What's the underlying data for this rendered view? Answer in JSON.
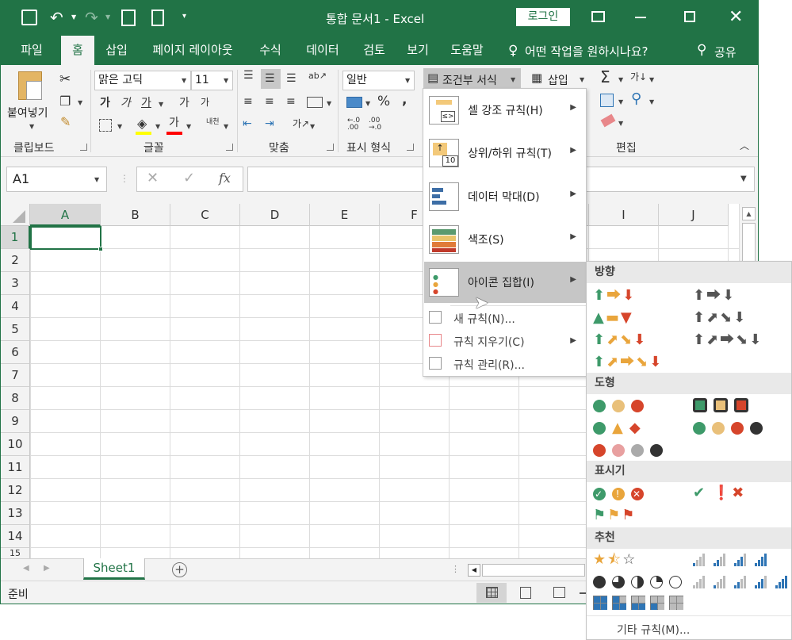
{
  "window": {
    "title": "통합 문서1  -  Excel",
    "login_label": "로그인"
  },
  "tabs": [
    {
      "label": "파일"
    },
    {
      "label": "홈"
    },
    {
      "label": "삽입"
    },
    {
      "label": "페이지 레이아웃"
    },
    {
      "label": "수식"
    },
    {
      "label": "데이터"
    },
    {
      "label": "검토"
    },
    {
      "label": "보기"
    },
    {
      "label": "도움말"
    }
  ],
  "tell_me": "어떤 작업을 원하시나요?",
  "share_label": "공유",
  "ribbon": {
    "paste_label": "붙여넣기",
    "clipboard_label": "클립보드",
    "font_label": "글꼴",
    "align_label": "맞춤",
    "number_label": "표시 형식",
    "edit_label": "편집",
    "font_name": "맑은 고딕",
    "font_size": "11",
    "number_format": "일반",
    "cond_format": "조건부 서식",
    "insert_label": "삽입",
    "bold": "가",
    "italic": "가",
    "underline": "가",
    "grow": "가",
    "shrink": "가",
    "font_color": "가",
    "phonetic": "내천",
    "percent": "%",
    "comma": ","
  },
  "formula_bar": {
    "name_box": "A1",
    "fx": "fx",
    "value": ""
  },
  "columns": [
    "A",
    "B",
    "C",
    "D",
    "E",
    "F",
    "G",
    "H",
    "I",
    "J"
  ],
  "rows": [
    "1",
    "2",
    "3",
    "4",
    "5",
    "6",
    "7",
    "8",
    "9",
    "10",
    "11",
    "12",
    "13",
    "14",
    "15"
  ],
  "cond_menu": {
    "items": [
      {
        "label": "셀 강조 규칙(H)"
      },
      {
        "label": "상위/하위 규칙(T)"
      },
      {
        "label": "데이터 막대(D)"
      },
      {
        "label": "색조(S)"
      },
      {
        "label": "아이콘 집합(I)"
      }
    ],
    "small_items": [
      {
        "label": "새 규칙(N)..."
      },
      {
        "label": "규칙 지우기(C)"
      },
      {
        "label": "규칙 관리(R)..."
      }
    ]
  },
  "icon_sets": {
    "sections": [
      "방향",
      "도형",
      "표시기",
      "추천"
    ],
    "more_rules": "기타 규칙(M)..."
  },
  "sheet": {
    "tab": "Sheet1"
  },
  "status": {
    "ready": "준비"
  },
  "colors": {
    "accent": "#217346",
    "green": "#3e9a6a",
    "yellow": "#e9a53c",
    "red": "#d6452b",
    "blue": "#2f75b5"
  }
}
